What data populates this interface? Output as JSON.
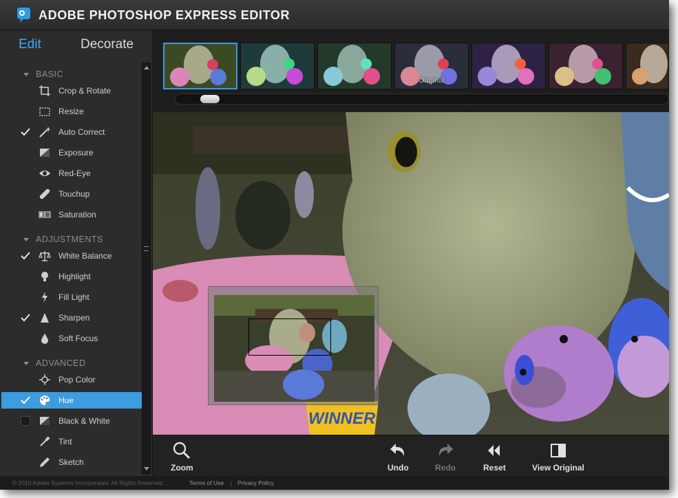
{
  "app": {
    "title": "ADOBE PHOTOSHOP EXPRESS EDITOR"
  },
  "mode_tabs": {
    "edit": "Edit",
    "decorate": "Decorate"
  },
  "sections": {
    "basic": "BASIC",
    "adjustments": "ADJUSTMENTS",
    "advanced": "ADVANCED"
  },
  "tools": {
    "crop": "Crop & Rotate",
    "resize": "Resize",
    "auto_correct": "Auto Correct",
    "exposure": "Exposure",
    "red_eye": "Red-Eye",
    "touchup": "Touchup",
    "saturation": "Saturation",
    "white_balance": "White Balance",
    "highlight": "Highlight",
    "fill_light": "Fill Light",
    "sharpen": "Sharpen",
    "soft_focus": "Soft Focus",
    "pop_color": "Pop Color",
    "hue": "Hue",
    "black_white": "Black & White",
    "tint": "Tint",
    "sketch": "Sketch"
  },
  "filmstrip": {
    "original_label": "Original",
    "selected_index": 0
  },
  "canvas": {
    "sign_text": "WINNER"
  },
  "toolbar": {
    "zoom": "Zoom",
    "undo": "Undo",
    "redo": "Redo",
    "reset": "Reset",
    "view_original": "View Original"
  },
  "footer": {
    "copyright": "© 2010 Adobe Systems Incorporated. All Rights Reserved.",
    "terms": "Terms of Use",
    "separator": "|",
    "privacy": "Privacy Policy"
  },
  "colors": {
    "accent": "#3d9be0",
    "edit_tab": "#3fa9f5"
  }
}
